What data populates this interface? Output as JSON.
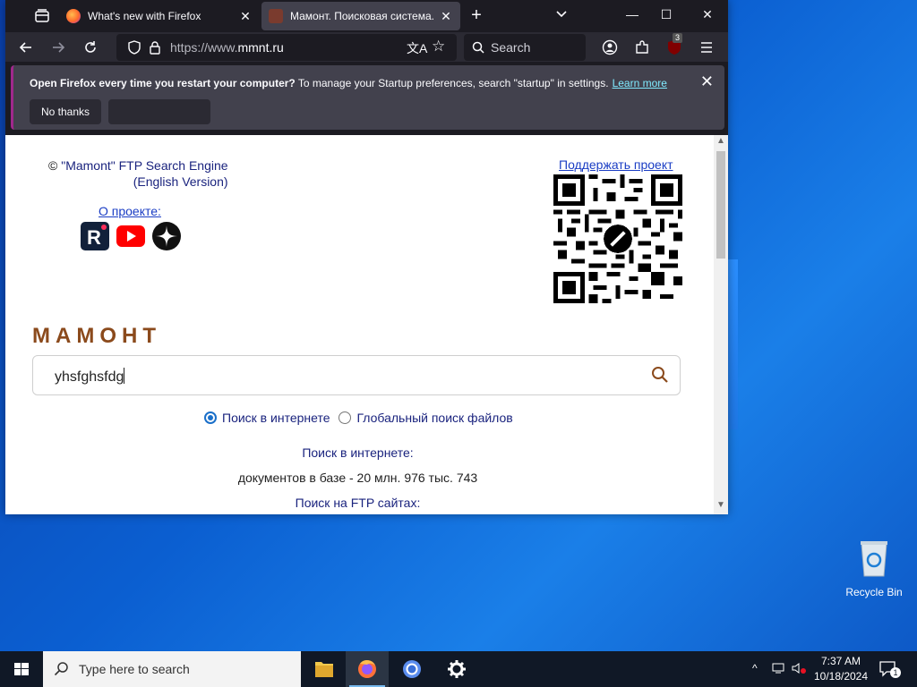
{
  "browser": {
    "tabs": [
      {
        "title": "What's new with Firefox",
        "active": false
      },
      {
        "title": "Мамонт. Поисковая система. ",
        "active": true
      }
    ],
    "url": {
      "prefix": "https://www.",
      "domain": "mmnt.ru"
    },
    "search_placeholder": "Search",
    "extension_badge": "3"
  },
  "notification": {
    "bold": "Open Firefox every time you restart your computer?",
    "text": " To manage your Startup preferences, search \"startup\" in settings.",
    "link": "Learn more",
    "no_thanks": "No thanks"
  },
  "page": {
    "copyright_symbol": "©",
    "copyright_link": "\"Mamont\" FTP Search Engine",
    "english_version": "(English Version)",
    "about": "О проекте:",
    "support": "Поддержать проект",
    "logo": "МАМОНТ",
    "search_value": "yhsfghsfdg",
    "radio_internet": "Поиск в интернете",
    "radio_files": "Глобальный поиск файлов",
    "stat_internet_heading": "Поиск в интернете:",
    "stat_internet_value": "документов в базе - 20 млн. 976 тыс. 743",
    "stat_ftp_heading": "Поиск на FTP сайтах:"
  },
  "desktop": {
    "recycle_bin": "Recycle Bin"
  },
  "taskbar": {
    "search_placeholder": "Type here to search",
    "time": "7:37 AM",
    "date": "10/18/2024",
    "notifications_count": "1"
  },
  "colors": {
    "logo": "#8b4a1c",
    "link": "#1a3dc4",
    "notification_accent": "#a0288c"
  }
}
